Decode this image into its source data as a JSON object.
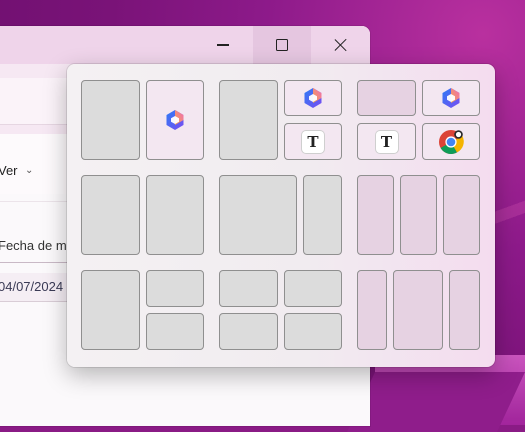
{
  "window": {
    "minimize_label": "",
    "maximize_label": "",
    "close_label": ""
  },
  "app": {
    "view_menu_label": "Ver",
    "column_header": "Fecha de m",
    "row_date": "04/07/2024"
  },
  "snap_layouts": {
    "layouts": [
      {
        "name": "two-halves",
        "zones": [
          "empty",
          "copilot"
        ]
      },
      {
        "name": "half-and-quarters",
        "zones": [
          "empty",
          "copilot",
          "text-app"
        ]
      },
      {
        "name": "two-by-two-with-apps",
        "zones": [
          "empty",
          "copilot",
          "text-app",
          "chrome"
        ]
      },
      {
        "name": "two-columns",
        "zones": [
          "empty",
          "empty"
        ]
      },
      {
        "name": "wide-and-narrow",
        "zones": [
          "empty",
          "empty"
        ]
      },
      {
        "name": "three-columns",
        "zones": [
          "empty",
          "empty",
          "empty"
        ]
      },
      {
        "name": "half-and-two-stacked",
        "zones": [
          "empty",
          "empty",
          "empty"
        ]
      },
      {
        "name": "four-quarters",
        "zones": [
          "empty",
          "empty",
          "empty",
          "empty"
        ]
      },
      {
        "name": "narrow-wide-narrow",
        "zones": [
          "empty",
          "empty",
          "empty"
        ]
      }
    ],
    "text_app_glyph": "T"
  },
  "icons": {
    "copilot": "copilot-icon",
    "text_app": "text-app-icon",
    "chrome": "chrome-icon"
  },
  "colors": {
    "zone_empty": "#dcdcdc",
    "zone_border": "#8f8f8f",
    "titlebar": "#efd4ea",
    "wallpaper": "#8a1b85"
  }
}
